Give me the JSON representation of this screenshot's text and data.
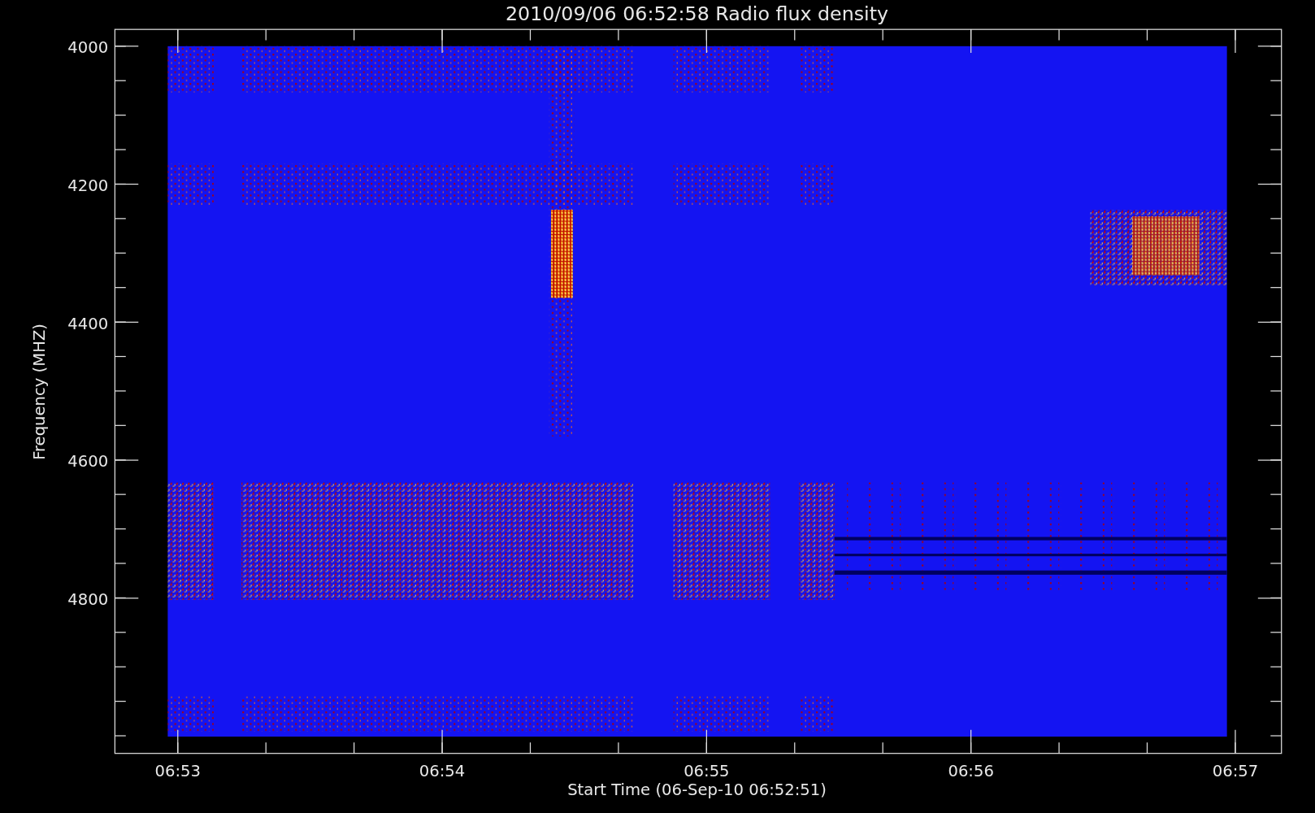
{
  "title": "2010/09/06 06:52:58 Radio flux density",
  "y_axis": {
    "label": "Frequency (MHZ)",
    "ticks": [
      "4000",
      "4200",
      "4400",
      "4600",
      "4800"
    ]
  },
  "x_axis": {
    "label": "Start Time (06-Sep-10 06:52:51)",
    "ticks": [
      "06:53",
      "06:54",
      "06:55",
      "06:56",
      "06:57"
    ]
  }
}
